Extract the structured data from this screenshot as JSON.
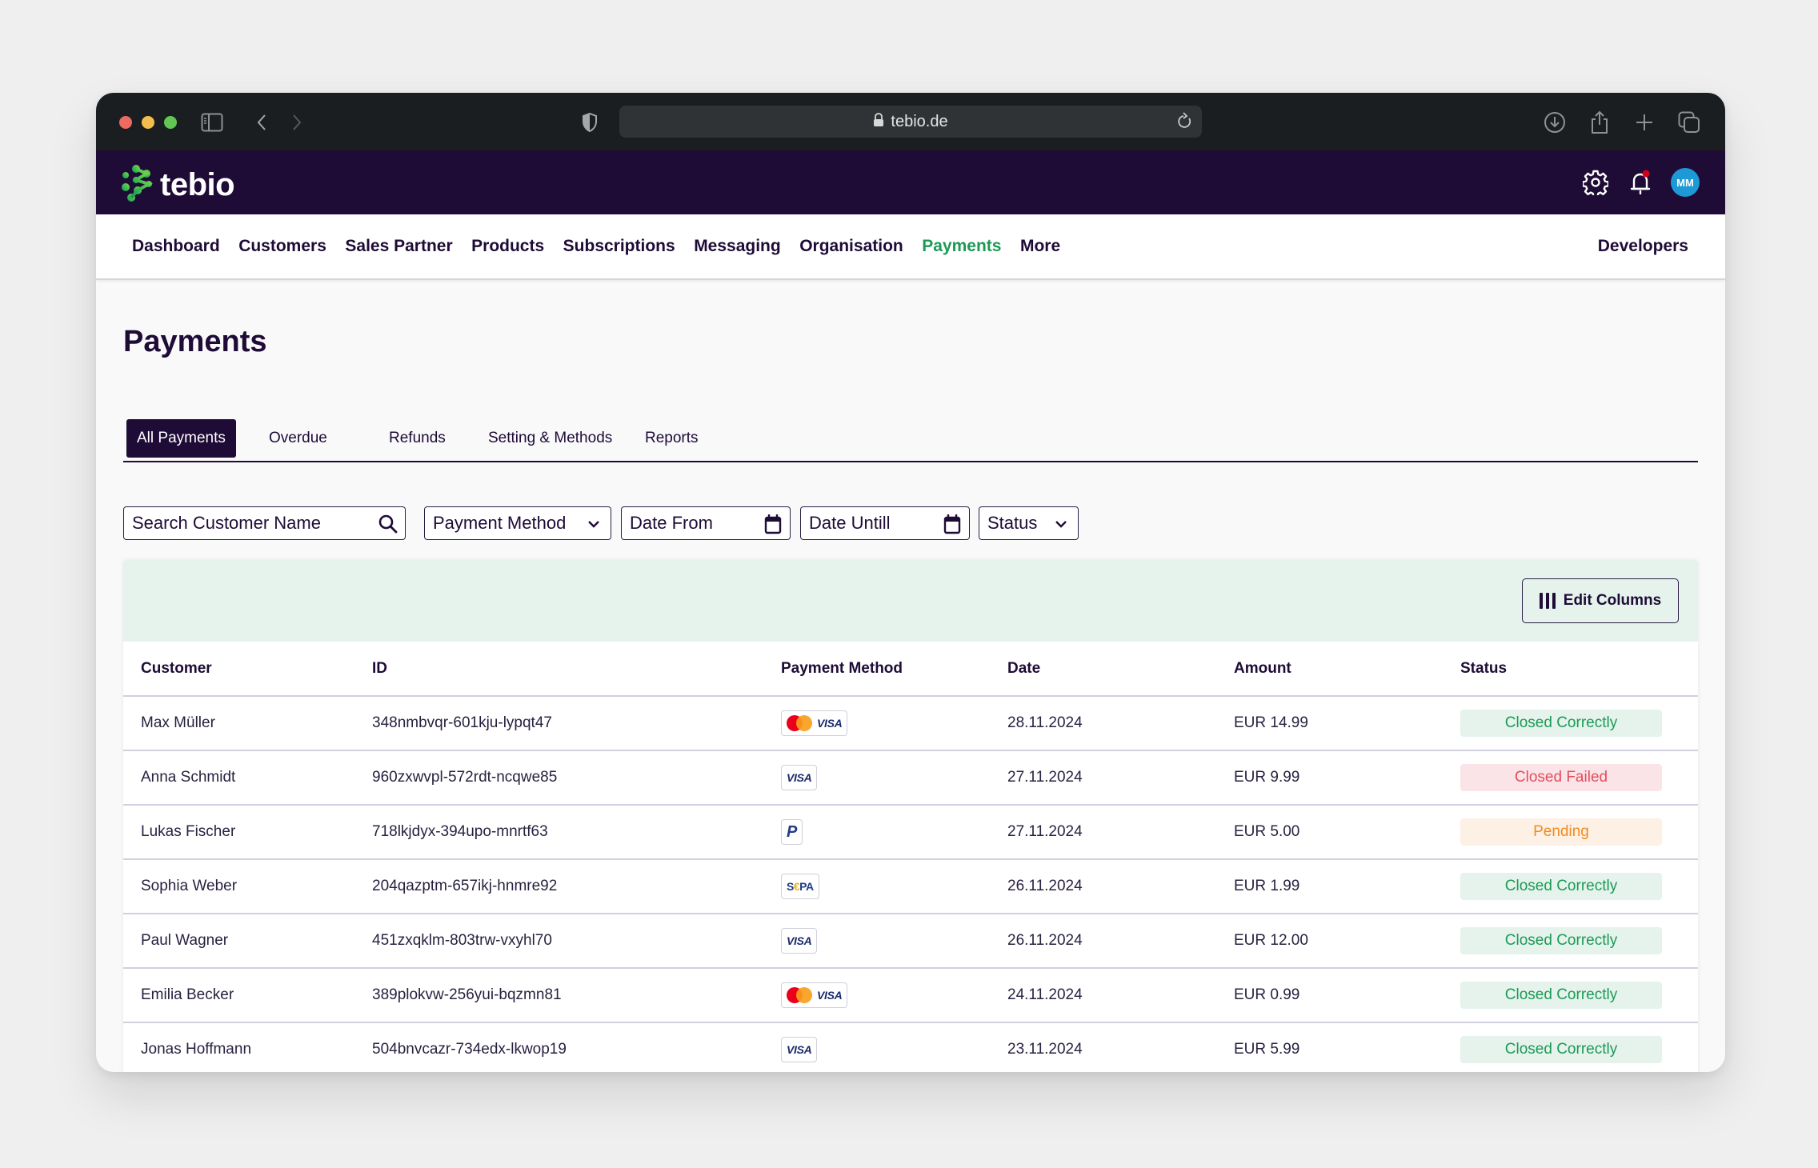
{
  "browser": {
    "url": "tebio.de",
    "icons": [
      "sidebar-toggle-icon",
      "back-icon",
      "forward-icon",
      "shield-icon",
      "lock-icon",
      "reload-icon",
      "download-icon",
      "share-icon",
      "new-tab-icon",
      "tabs-overview-icon"
    ]
  },
  "header": {
    "logo_text": "tebio",
    "avatar_initials": "MM",
    "notification_dot_color": "#d0021b"
  },
  "nav": {
    "items": [
      {
        "label": "Dashboard",
        "active": false
      },
      {
        "label": "Customers",
        "active": false
      },
      {
        "label": "Sales Partner",
        "active": false
      },
      {
        "label": "Products",
        "active": false
      },
      {
        "label": "Subscriptions",
        "active": false
      },
      {
        "label": "Messaging",
        "active": false
      },
      {
        "label": "Organisation",
        "active": false
      },
      {
        "label": "Payments",
        "active": true
      },
      {
        "label": "More",
        "active": false
      }
    ],
    "developers": "Developers"
  },
  "page": {
    "title": "Payments",
    "tabs": [
      {
        "label": "All Payments",
        "active": true
      },
      {
        "label": "Overdue",
        "active": false
      },
      {
        "label": "Refunds",
        "active": false
      },
      {
        "label": "Setting & Methods",
        "active": false
      },
      {
        "label": "Reports",
        "active": false
      }
    ]
  },
  "filters": {
    "search_placeholder": "Search Customer Name",
    "search_value": "",
    "payment_method": "Payment Method",
    "date_from": "Date From",
    "date_until": "Date Untill",
    "status": "Status"
  },
  "table": {
    "edit_columns_label": "Edit Columns",
    "columns": [
      "Customer",
      "ID",
      "Payment Method",
      "Date",
      "Amount",
      "Status"
    ],
    "rows": [
      {
        "customer": "Max Müller",
        "id": "348nmbvqr-601kju-lypqt47",
        "methods": [
          "mastercard",
          "visa"
        ],
        "date": "28.11.2024",
        "amount": "EUR 14.99",
        "status": "Closed Correctly",
        "status_type": "ok"
      },
      {
        "customer": "Anna Schmidt",
        "id": "960zxwvpl-572rdt-ncqwe85",
        "methods": [
          "visa"
        ],
        "date": "27.11.2024",
        "amount": "EUR 9.99",
        "status": "Closed Failed",
        "status_type": "fail"
      },
      {
        "customer": "Lukas Fischer",
        "id": "718lkjdyx-394upo-mnrtf63",
        "methods": [
          "paypal"
        ],
        "date": "27.11.2024",
        "amount": "EUR 5.00",
        "status": "Pending",
        "status_type": "pending"
      },
      {
        "customer": "Sophia Weber",
        "id": "204qazptm-657ikj-hnmre92",
        "methods": [
          "sepa"
        ],
        "date": "26.11.2024",
        "amount": "EUR 1.99",
        "status": "Closed Correctly",
        "status_type": "ok"
      },
      {
        "customer": "Paul Wagner",
        "id": "451zxqklm-803trw-vxyhl70",
        "methods": [
          "visa"
        ],
        "date": "26.11.2024",
        "amount": "EUR 12.00",
        "status": "Closed Correctly",
        "status_type": "ok"
      },
      {
        "customer": "Emilia Becker",
        "id": "389plokvw-256yui-bqzmn81",
        "methods": [
          "mastercard",
          "visa"
        ],
        "date": "24.11.2024",
        "amount": "EUR 0.99",
        "status": "Closed Correctly",
        "status_type": "ok"
      },
      {
        "customer": "Jonas Hoffmann",
        "id": "504bnvcazr-734edx-lkwop19",
        "methods": [
          "visa"
        ],
        "date": "23.11.2024",
        "amount": "EUR 5.99",
        "status": "Closed Correctly",
        "status_type": "ok"
      }
    ]
  },
  "colors": {
    "brand_dark": "#1e0b36",
    "accent_green": "#1c9a55",
    "status_ok_bg": "#e5f3ec",
    "status_fail_bg": "#fbe4e8",
    "status_fail_text": "#e54c5c",
    "status_pending_bg": "#fdf0e4",
    "status_pending_text": "#f28a1c",
    "avatar_bg": "#1d9ad6"
  },
  "method_labels": {
    "visa": "VISA",
    "paypal": "P",
    "sepa_prefix": "S",
    "sepa_euro": "€",
    "sepa_suffix": "PA"
  }
}
